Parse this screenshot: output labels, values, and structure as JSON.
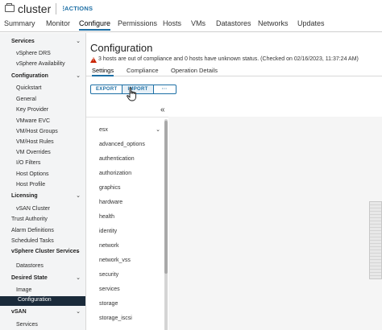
{
  "header": {
    "object_name": "cluster",
    "actions_label": "ACTIONS"
  },
  "tabs": [
    "Summary",
    "Monitor",
    "Configure",
    "Permissions",
    "Hosts",
    "VMs",
    "Datastores",
    "Networks",
    "Updates"
  ],
  "active_tab": "Configure",
  "sidebar": {
    "rows": [
      {
        "label": "Services",
        "type": "section",
        "chevron": "⌄"
      },
      {
        "label": "vSphere DRS",
        "type": "item"
      },
      {
        "label": "vSphere Availability",
        "type": "item"
      },
      {
        "label": "Configuration",
        "type": "section",
        "chevron": "⌄"
      },
      {
        "label": "Quickstart",
        "type": "item"
      },
      {
        "label": "General",
        "type": "item"
      },
      {
        "label": "Key Provider",
        "type": "item"
      },
      {
        "label": "VMware EVC",
        "type": "item"
      },
      {
        "label": "VM/Host Groups",
        "type": "item"
      },
      {
        "label": "VM/Host Rules",
        "type": "item"
      },
      {
        "label": "VM Overrides",
        "type": "item"
      },
      {
        "label": "I/O Filters",
        "type": "item"
      },
      {
        "label": "Host Options",
        "type": "item"
      },
      {
        "label": "Host Profile",
        "type": "item"
      },
      {
        "label": "Licensing",
        "type": "section",
        "chevron": "⌄"
      },
      {
        "label": "vSAN Cluster",
        "type": "item"
      },
      {
        "label": "Trust Authority",
        "type": "plain"
      },
      {
        "label": "Alarm Definitions",
        "type": "plain"
      },
      {
        "label": "Scheduled Tasks",
        "type": "plain"
      },
      {
        "label": "vSphere Cluster Services",
        "type": "section",
        "chevron": "⌄"
      },
      {
        "label": "Datastores",
        "type": "item"
      },
      {
        "label": "Desired State",
        "type": "section",
        "chevron": "⌄"
      },
      {
        "label": "Image",
        "type": "item"
      },
      {
        "label": "Configuration",
        "type": "item",
        "selected": true
      },
      {
        "label": "vSAN",
        "type": "section",
        "chevron": "⌄"
      },
      {
        "label": "Services",
        "type": "item"
      }
    ]
  },
  "main": {
    "title": "Configuration",
    "warning": "3 hosts are out of compliance and 0 hosts have unknown status. (Checked on 02/16/2023, 11:37:24 AM)",
    "subtabs": [
      "Settings",
      "Compliance",
      "Operation Details"
    ],
    "active_subtab": "Settings",
    "buttons": [
      "EXPORT",
      "IMPORT",
      "···"
    ],
    "collapse_icon": "«",
    "tree": [
      {
        "label": "esx",
        "chevron": "⌄"
      },
      {
        "label": "advanced_options"
      },
      {
        "label": "authentication"
      },
      {
        "label": "authorization"
      },
      {
        "label": "graphics"
      },
      {
        "label": "hardware"
      },
      {
        "label": "health"
      },
      {
        "label": "identity"
      },
      {
        "label": "network"
      },
      {
        "label": "network_vss"
      },
      {
        "label": "security"
      },
      {
        "label": "services"
      },
      {
        "label": "storage"
      },
      {
        "label": "storage_iscsi"
      }
    ]
  },
  "colors": {
    "accent": "#1d6fa5",
    "selected_nav_bg": "#1a2a3a",
    "warning": "#c92100"
  }
}
